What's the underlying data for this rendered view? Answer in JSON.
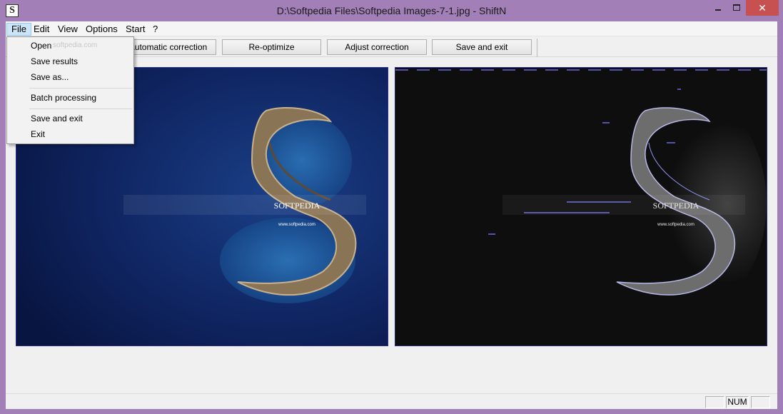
{
  "window": {
    "title": "D:\\Softpedia Files\\Softpedia Images-7-1.jpg - ShiftN",
    "icon_letter": "S",
    "close_glyph": "✕"
  },
  "menubar": {
    "items": [
      "File",
      "Edit",
      "View",
      "Options",
      "Start",
      "?"
    ]
  },
  "toolbar": {
    "automatic_label": "Automatic correction",
    "reoptimize_label": "Re-optimize",
    "adjust_label": "Adjust correction",
    "save_exit_label": "Save and exit"
  },
  "file_menu": {
    "items": [
      "Open",
      "Save results",
      "Save as...",
      "Batch processing",
      "Save and exit",
      "Exit"
    ]
  },
  "images": {
    "left": {
      "brand": "SOFTPEDIA",
      "url": "www.softpedia.com"
    },
    "right": {
      "brand": "SOFTPEDIA",
      "url": "www.softpedia.com"
    }
  },
  "watermark": "softpedia.com",
  "statusbar": {
    "num_label": "NUM"
  },
  "colors": {
    "titlebar": "#a37fb7",
    "close_button": "#c75050",
    "menu_highlight": "#cce4f7",
    "panel_border": "#2a2a8e"
  }
}
